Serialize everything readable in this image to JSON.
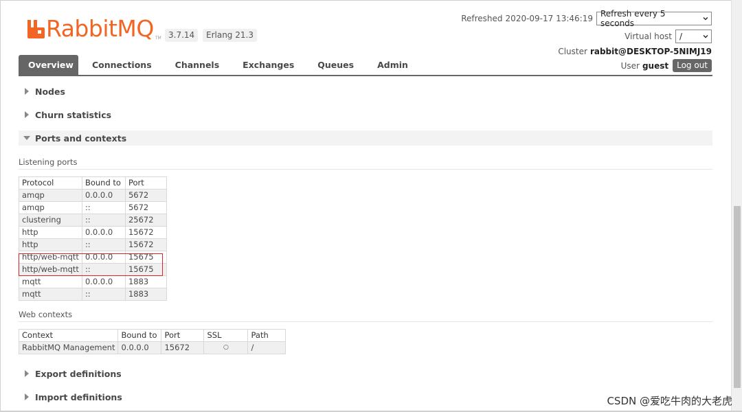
{
  "brand": {
    "name": "RabbitMQ",
    "tm": "TM",
    "version": "3.7.14",
    "erlang": "Erlang 21.3",
    "color": "#f26522"
  },
  "header": {
    "refreshed_label": "Refreshed",
    "refreshed_time": "2020-09-17 13:46:19",
    "refresh_select": "Refresh every 5 seconds",
    "vhost_label": "Virtual host",
    "vhost_select": "/",
    "cluster_label": "Cluster",
    "cluster_name": "rabbit@DESKTOP-5NIMJ19",
    "user_label": "User",
    "user_name": "guest",
    "logout_label": "Log out"
  },
  "tabs": [
    "Overview",
    "Connections",
    "Channels",
    "Exchanges",
    "Queues",
    "Admin"
  ],
  "sections": {
    "nodes": "Nodes",
    "churn": "Churn statistics",
    "ports": "Ports and contexts",
    "export": "Export definitions",
    "import": "Import definitions"
  },
  "listening_ports": {
    "heading": "Listening ports",
    "columns": [
      "Protocol",
      "Bound to",
      "Port"
    ],
    "rows": [
      [
        "amqp",
        "0.0.0.0",
        "5672"
      ],
      [
        "amqp",
        "::",
        "5672"
      ],
      [
        "clustering",
        "::",
        "25672"
      ],
      [
        "http",
        "0.0.0.0",
        "15672"
      ],
      [
        "http",
        "::",
        "15672"
      ],
      [
        "http/web-mqtt",
        "0.0.0.0",
        "15675"
      ],
      [
        "http/web-mqtt",
        "::",
        "15675"
      ],
      [
        "mqtt",
        "0.0.0.0",
        "1883"
      ],
      [
        "mqtt",
        "::",
        "1883"
      ]
    ]
  },
  "web_contexts": {
    "heading": "Web contexts",
    "columns": [
      "Context",
      "Bound to",
      "Port",
      "SSL",
      "Path"
    ],
    "rows": [
      [
        "RabbitMQ Management",
        "0.0.0.0",
        "15672",
        "○",
        "/"
      ]
    ]
  },
  "watermark": "CSDN @爱吃牛肉的大老虎"
}
